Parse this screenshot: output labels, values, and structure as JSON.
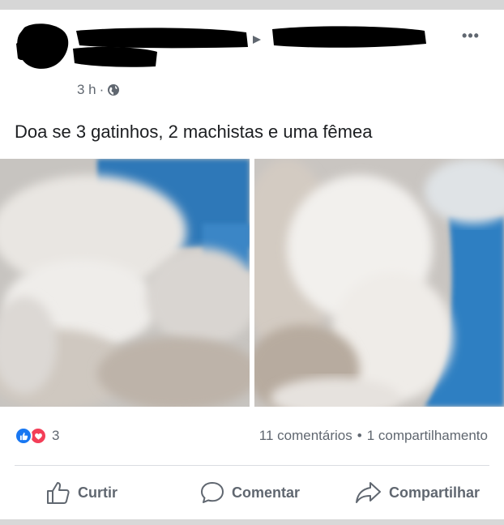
{
  "post": {
    "time": "3 h",
    "dot": "·",
    "privacy_icon": "globe-icon",
    "text": "Doa se 3 gatinhos, 2 machistas e uma fêmea",
    "more_icon": "•••"
  },
  "reactions": {
    "icons": [
      "like-icon",
      "love-icon"
    ],
    "count": "3",
    "colors": {
      "like": "#1877f2",
      "love": "#f33e58"
    }
  },
  "stats": {
    "comments": "11 comentários",
    "separator": "•",
    "shares": "1 compartilhamento"
  },
  "actions": {
    "like": "Curtir",
    "comment": "Comentar",
    "share": "Compartilhar"
  },
  "colors": {
    "text": "#1c1e21",
    "secondary": "#606770",
    "divider": "#dadde1"
  }
}
